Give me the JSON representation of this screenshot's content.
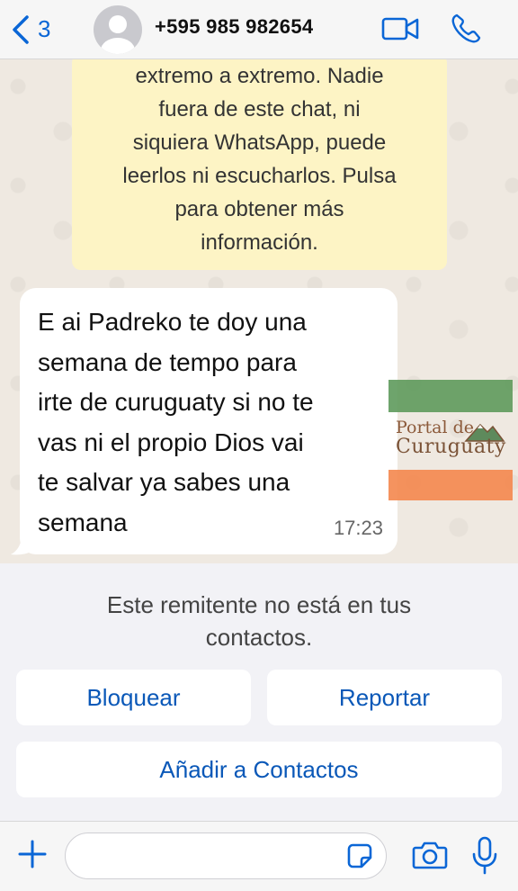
{
  "header": {
    "back_count": "3",
    "contact_name": "+595 985 982654",
    "icons": [
      "chevron-left-icon",
      "avatar",
      "video-call-icon",
      "phone-icon"
    ]
  },
  "chat": {
    "system_note": "extremo a extremo. Nadie fuera de este chat, ni siquiera WhatsApp, puede leerlos ni escucharlos. Pulsa para obtener más información.",
    "system_note_lines": [
      "extremo a extremo. Nadie",
      "fuera de este chat, ni",
      "siquiera WhatsApp, puede",
      "leerlos ni escucharlos. Pulsa",
      "para obtener más",
      "información."
    ],
    "message": {
      "lines": [
        "E ai Padreko te doy una",
        "semana de tempo para",
        "irte de curuguaty si no te",
        "vas ni el propio Dios vai",
        "te salvar ya sabes una",
        "semana"
      ],
      "time": "17:23"
    },
    "watermark": {
      "line1": "Portal de",
      "line2": "Curuguaty"
    }
  },
  "unknown_sender": {
    "message": "Este remitente no está en tus contactos.",
    "block_label": "Bloquear",
    "report_label": "Reportar",
    "add_label": "Añadir a Contactos"
  },
  "input_bar": {
    "placeholder": "",
    "icons": [
      "plus-icon",
      "sticker-icon",
      "camera-icon",
      "microphone-icon"
    ]
  },
  "colors": {
    "accent": "#0a66d6",
    "chat_background": "#efe9e1",
    "system_note_bg": "#fdf4c5",
    "bubble_bg": "#ffffff"
  }
}
